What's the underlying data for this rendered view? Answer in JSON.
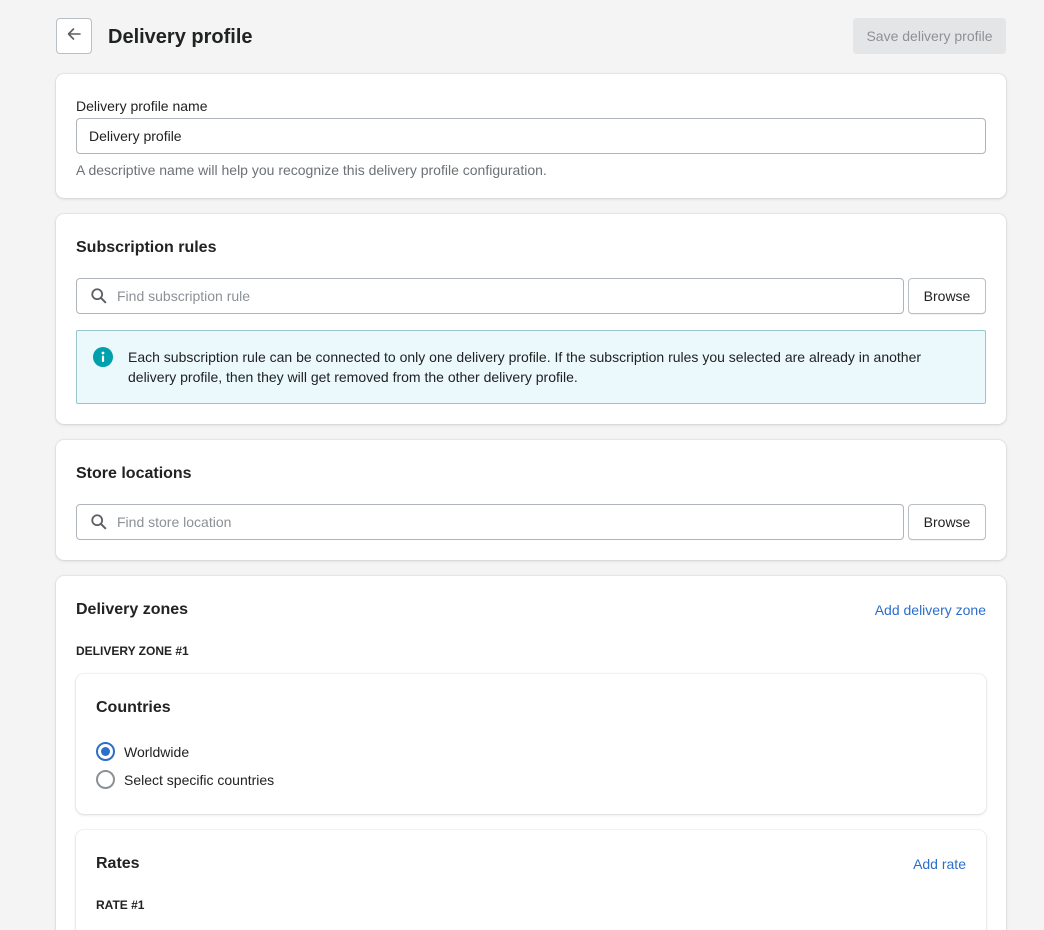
{
  "header": {
    "title": "Delivery profile",
    "save_label": "Save delivery profile"
  },
  "profile_name": {
    "label": "Delivery profile name",
    "value": "Delivery profile",
    "help": "A descriptive name will help you recognize this delivery profile configuration."
  },
  "subscription_rules": {
    "title": "Subscription rules",
    "search_placeholder": "Find subscription rule",
    "browse_label": "Browse",
    "banner_text": "Each subscription rule can be connected to only one delivery profile. If the subscription rules you selected are already in another delivery profile, then they will get removed from the other delivery profile."
  },
  "store_locations": {
    "title": "Store locations",
    "search_placeholder": "Find store location",
    "browse_label": "Browse"
  },
  "delivery_zones": {
    "title": "Delivery zones",
    "add_label": "Add delivery zone",
    "zone_heading": "DELIVERY ZONE #1",
    "countries": {
      "title": "Countries",
      "options": [
        {
          "label": "Worldwide",
          "checked": true
        },
        {
          "label": "Select specific countries",
          "checked": false
        }
      ]
    },
    "rates": {
      "title": "Rates",
      "add_label": "Add rate",
      "rate_heading": "RATE #1"
    }
  },
  "colors": {
    "accent": "#2c6ecb",
    "info": "#00a0ac",
    "banner_bg": "#ebf9fc"
  }
}
